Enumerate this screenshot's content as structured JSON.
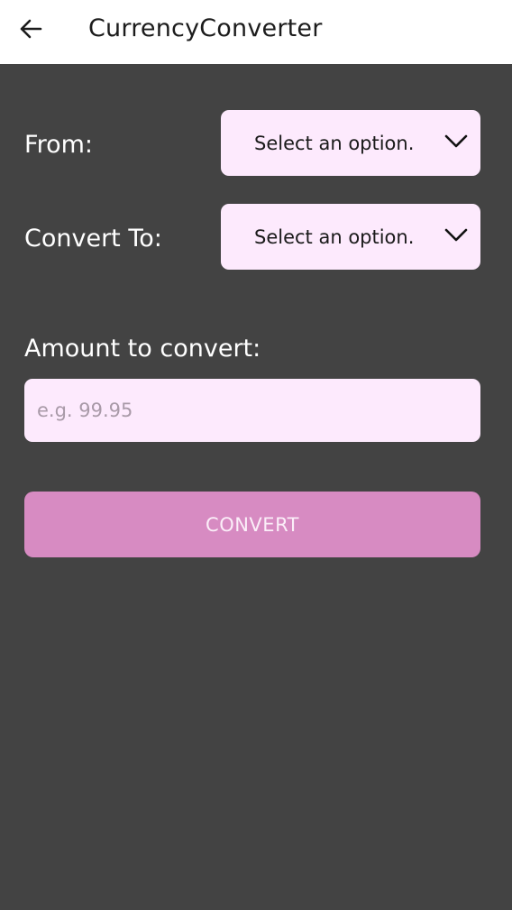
{
  "app_bar": {
    "back_icon": "arrow-left-icon",
    "title": "CurrencyConverter"
  },
  "form": {
    "from_label": "From:",
    "from_select": {
      "value": "Select an option.",
      "icon": "chevron-down-icon"
    },
    "to_label": "Convert To:",
    "to_select": {
      "value": "Select an option.",
      "icon": "chevron-down-icon"
    },
    "amount_label": "Amount to convert:",
    "amount_input": {
      "value": "",
      "placeholder": "e.g. 99.95"
    },
    "convert_button": "CONVERT"
  },
  "colors": {
    "background": "#434343",
    "app_bar": "#ffffff",
    "field_background": "#fdeafd",
    "button_background": "#d78bc2",
    "button_text": "#fbeef8"
  }
}
